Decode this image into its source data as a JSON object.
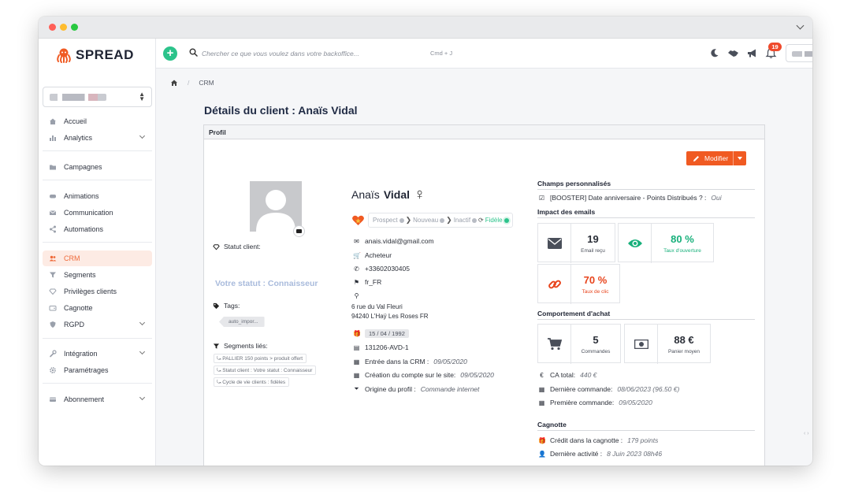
{
  "app": {
    "brand": "SPREAD",
    "brand_color": "#f05a22",
    "accent_green": "#2cc38b"
  },
  "topbar": {
    "search_placeholder": "Chercher ce que vous voulez dans votre backoffice...",
    "shortcut": "Cmd + J",
    "notifications_count": "19"
  },
  "sidebar": {
    "items": [
      {
        "label": "Accueil",
        "icon": "home-icon"
      },
      {
        "label": "Analytics",
        "icon": "bar-chart-icon",
        "expandable": true
      },
      {
        "label": "Campagnes",
        "icon": "folder-icon"
      },
      {
        "label": "Animations",
        "icon": "ticket-icon"
      },
      {
        "label": "Communication",
        "icon": "envelope-icon"
      },
      {
        "label": "Automations",
        "icon": "share-icon"
      },
      {
        "label": "CRM",
        "icon": "users-icon",
        "active": true
      },
      {
        "label": "Segments",
        "icon": "filter-icon"
      },
      {
        "label": "Privilèges clients",
        "icon": "gem-icon"
      },
      {
        "label": "Cagnotte",
        "icon": "wallet-icon"
      },
      {
        "label": "RGPD",
        "icon": "shield-icon",
        "expandable": true
      },
      {
        "label": "Intégration",
        "icon": "wrench-icon",
        "expandable": true
      },
      {
        "label": "Paramétrages",
        "icon": "gear-icon"
      },
      {
        "label": "Abonnement",
        "icon": "card-icon",
        "expandable": true
      }
    ]
  },
  "breadcrumb": {
    "current": "CRM"
  },
  "page": {
    "title": "Détails du client : Anaïs Vidal"
  },
  "profile": {
    "card_title": "Profil",
    "modify_label": "Modifier",
    "first_name": "Anaïs",
    "last_name": "Vidal",
    "gender_symbol": "♀",
    "status_label": "Statut client:",
    "status_value": "Votre statut : Connaisseur",
    "tags_label": "Tags:",
    "tags": [
      "auto_impor..."
    ],
    "segments_label": "Segments liés:",
    "segments": [
      "PALLIER 150 points > produit offert",
      "Statut client : Votre statut : Connaisseur",
      "Cycle de vie clients : fidèles"
    ],
    "lifecycle": [
      {
        "label": "Prospect",
        "current": false
      },
      {
        "label": "Nouveau",
        "current": false
      },
      {
        "label": "Inactif",
        "current": false
      },
      {
        "label": "Fidèle",
        "current": true
      }
    ],
    "email": "anais.vidal@gmail.com",
    "role": "Acheteur",
    "phone": "+33602030405",
    "locale": "fr_FR",
    "address_line1": "6 rue du Val Fleuri",
    "address_line2": "94240 L'Haÿ Les Roses FR",
    "birthday": "15 / 04 / 1992",
    "customer_id": "131206-AVD-1",
    "crm_entry_label": "Entrée dans la CRM :",
    "crm_entry_date": "09/05/2020",
    "account_created_label": "Création du compte sur le site:",
    "account_created_date": "09/05/2020",
    "origin_label": "Origine du profil :",
    "origin_value": "Commande internet"
  },
  "custom_fields": {
    "title": "Champs personnalisés",
    "row_label": "[BOOSTER] Date anniversaire - Points Distribués ? :",
    "row_value": "Oui"
  },
  "email_impact": {
    "title": "Impact des emails",
    "received_value": "19",
    "received_label": "Email reçu",
    "open_rate_value": "80 %",
    "open_rate_label": "Taux d'ouverture",
    "click_rate_value": "70 %",
    "click_rate_label": "Taux de clic"
  },
  "purchase": {
    "title": "Comportement d'achat",
    "orders_value": "5",
    "orders_label": "Commandes",
    "basket_value": "88 €",
    "basket_label": "Panier moyen",
    "ca_label": "CA total:",
    "ca_value": "440 €",
    "last_order_label": "Dernière commande:",
    "last_order_value": "08/06/2023 (96.50 €)",
    "first_order_label": "Première commande:",
    "first_order_value": "09/05/2020"
  },
  "cagnotte": {
    "title": "Cagnotte",
    "credit_label": "Crédit dans la cagnotte :",
    "credit_value": "179 points",
    "last_activity_label": "Dernière activité :",
    "last_activity_value": "8 Juin 2023 08h46"
  }
}
